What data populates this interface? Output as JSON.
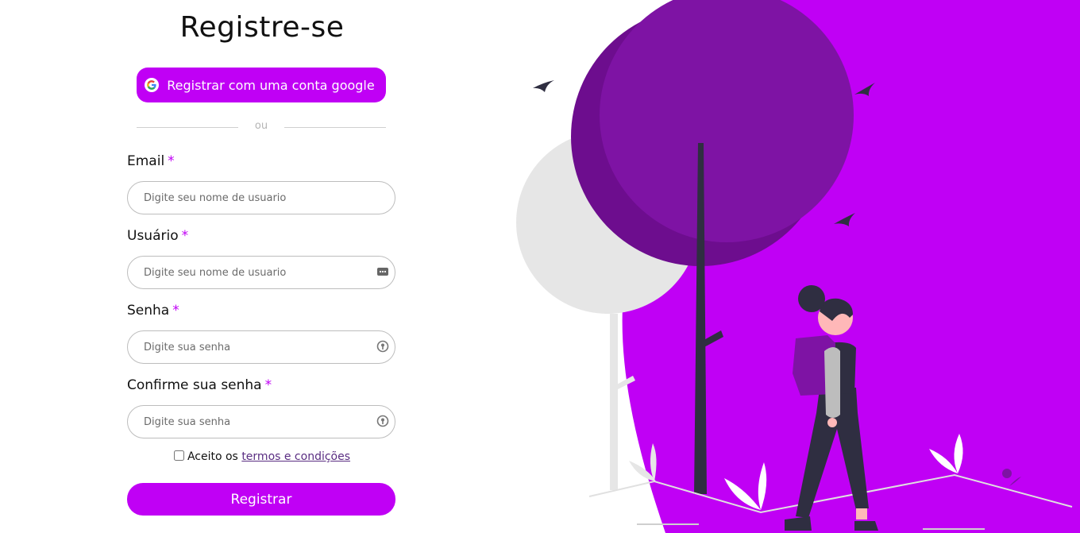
{
  "page": {
    "title": "Registre-se",
    "google_button": "Registrar com uma conta google",
    "divider": "ou",
    "submit": "Registrar"
  },
  "fields": {
    "email": {
      "label": "Email",
      "required": "*",
      "placeholder": "Digite seu nome de usuario"
    },
    "username": {
      "label": "Usuário",
      "required": "*",
      "placeholder": "Digite seu nome de usuario"
    },
    "password": {
      "label": "Senha",
      "required": "*",
      "placeholder": "Digite sua senha"
    },
    "confirm": {
      "label": "Confirme sua senha",
      "required": "*",
      "placeholder": "Digite sua senha"
    }
  },
  "terms": {
    "prefix": "Aceito os",
    "link": "termos e condições",
    "checked": false
  },
  "icons": [
    "google-icon",
    "password-manager-icon",
    "password-key-icon",
    "password-key-icon"
  ],
  "colors": {
    "accent": "#c000f5",
    "tree": "#7a12a0",
    "dark": "#2f2e41"
  }
}
